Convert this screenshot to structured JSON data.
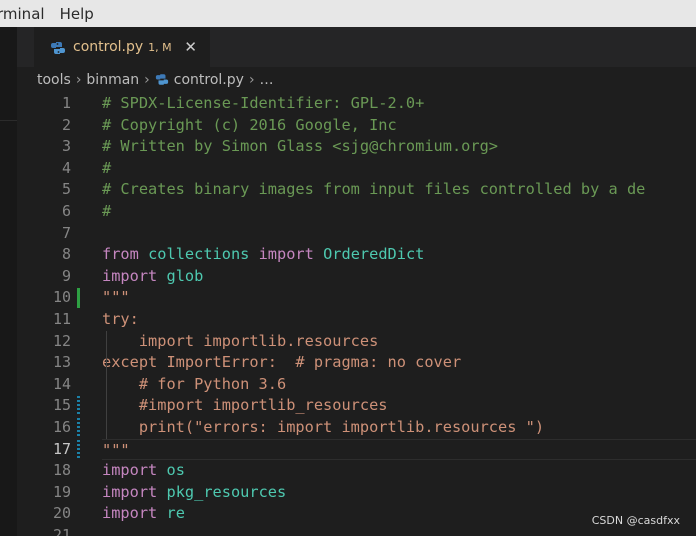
{
  "menubar": {
    "items": [
      "rminal",
      "Help"
    ]
  },
  "tab": {
    "label": "control.py",
    "badge": "1, M",
    "close_glyph": "✕",
    "icon": "python-icon"
  },
  "breadcrumb": {
    "items": [
      "tools",
      "binman",
      "control.py",
      "…"
    ],
    "separator": "›"
  },
  "editor": {
    "active_line": 17,
    "lines": [
      {
        "n": "1",
        "tokens": [
          {
            "t": "# SPDX-License-Identifier: GPL-2.0+",
            "c": "comment"
          }
        ]
      },
      {
        "n": "2",
        "tokens": [
          {
            "t": "# Copyright (c) 2016 Google, Inc",
            "c": "comment"
          }
        ]
      },
      {
        "n": "3",
        "tokens": [
          {
            "t": "# Written by Simon Glass <sjg@chromium.org>",
            "c": "comment"
          }
        ]
      },
      {
        "n": "4",
        "tokens": [
          {
            "t": "#",
            "c": "comment"
          }
        ]
      },
      {
        "n": "5",
        "tokens": [
          {
            "t": "# Creates binary images from input files controlled by a de",
            "c": "comment"
          }
        ]
      },
      {
        "n": "6",
        "tokens": [
          {
            "t": "#",
            "c": "comment"
          }
        ]
      },
      {
        "n": "7",
        "tokens": []
      },
      {
        "n": "8",
        "tokens": [
          {
            "t": "from",
            "c": "keyword"
          },
          {
            "t": " ",
            "c": "plain"
          },
          {
            "t": "collections",
            "c": "module"
          },
          {
            "t": " ",
            "c": "plain"
          },
          {
            "t": "import",
            "c": "keyword"
          },
          {
            "t": " ",
            "c": "plain"
          },
          {
            "t": "OrderedDict",
            "c": "module"
          }
        ]
      },
      {
        "n": "9",
        "tokens": [
          {
            "t": "import",
            "c": "keyword"
          },
          {
            "t": " ",
            "c": "plain"
          },
          {
            "t": "glob",
            "c": "module"
          }
        ]
      },
      {
        "n": "10",
        "tokens": [
          {
            "t": "\"\"\"",
            "c": "string"
          }
        ]
      },
      {
        "n": "11",
        "tokens": [
          {
            "t": "try:",
            "c": "string"
          }
        ]
      },
      {
        "n": "12",
        "tokens": [
          {
            "t": "    import importlib.resources",
            "c": "string"
          }
        ]
      },
      {
        "n": "13",
        "tokens": [
          {
            "t": "except ImportError:  # pragma: no cover",
            "c": "string"
          }
        ]
      },
      {
        "n": "14",
        "tokens": [
          {
            "t": "    # for Python 3.6",
            "c": "string"
          }
        ]
      },
      {
        "n": "15",
        "tokens": [
          {
            "t": "    #import importlib_resources",
            "c": "string"
          }
        ]
      },
      {
        "n": "16",
        "tokens": [
          {
            "t": "    print(\"errors: import importlib.resources \")",
            "c": "string"
          }
        ]
      },
      {
        "n": "17",
        "tokens": [
          {
            "t": "\"\"\"",
            "c": "string"
          }
        ]
      },
      {
        "n": "18",
        "tokens": [
          {
            "t": "import",
            "c": "keyword"
          },
          {
            "t": " ",
            "c": "plain"
          },
          {
            "t": "os",
            "c": "module"
          }
        ]
      },
      {
        "n": "19",
        "tokens": [
          {
            "t": "import",
            "c": "keyword"
          },
          {
            "t": " ",
            "c": "plain"
          },
          {
            "t": "pkg_resources",
            "c": "module"
          }
        ]
      },
      {
        "n": "20",
        "tokens": [
          {
            "t": "import",
            "c": "keyword"
          },
          {
            "t": " ",
            "c": "plain"
          },
          {
            "t": "re",
            "c": "module"
          }
        ]
      },
      {
        "n": "21",
        "tokens": []
      }
    ],
    "gutter_markers": [
      {
        "line": 10,
        "type": "added"
      },
      {
        "line": 15,
        "type": "modified"
      },
      {
        "line": 16,
        "type": "modified"
      },
      {
        "line": 17,
        "type": "modified"
      }
    ]
  },
  "colors": {
    "comment": "#6a9955",
    "keyword": "#c586c0",
    "module": "#4ec9b0",
    "string": "#ce9178",
    "tab_text": "#e2c08d",
    "added": "#2ea043",
    "modified": "#1b81a8"
  },
  "watermark": "CSDN @casdfxx"
}
